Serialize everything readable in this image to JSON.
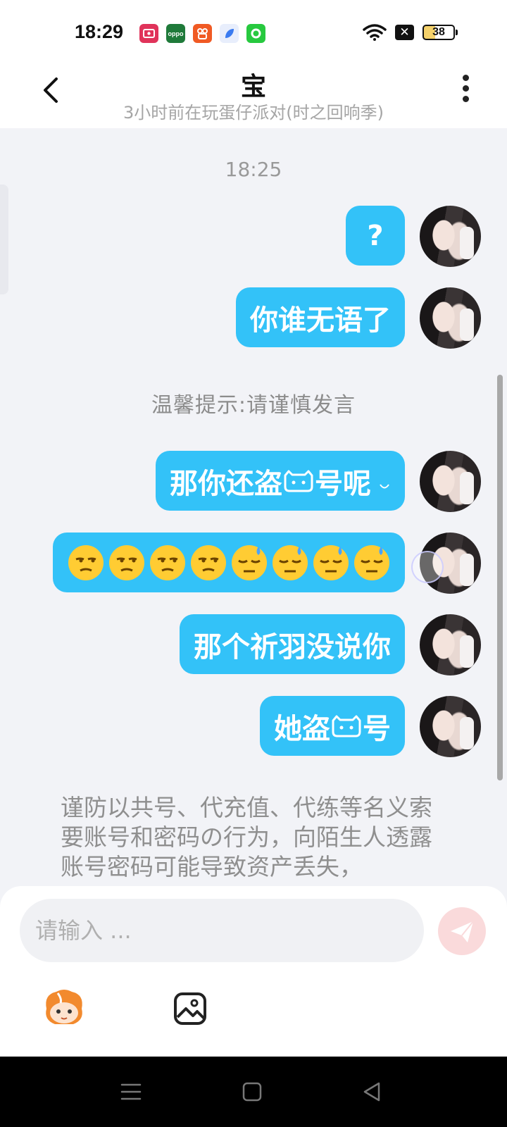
{
  "status_bar": {
    "time": "18:29",
    "battery": "38",
    "app_icons": [
      {
        "name": "screen-recorder-icon",
        "color": "#e0335a",
        "label": ""
      },
      {
        "name": "oppo-icon",
        "color": "#1f7a3a",
        "label": "oppo"
      },
      {
        "name": "kuaishou-icon",
        "color": "#f05a24",
        "label": ""
      },
      {
        "name": "feather-app-icon",
        "color": "#3a7bf0",
        "label": ""
      },
      {
        "name": "green-ring-app-icon",
        "color": "#27c93f",
        "label": ""
      }
    ]
  },
  "header": {
    "title": "宝",
    "subtitle": "3小时前在玩蛋仔派对(时之回响季)"
  },
  "chat": {
    "timestamp": "18:25",
    "tip": "温馨提示:请谨慎发言",
    "messages": [
      {
        "text": "?"
      },
      {
        "text": "你谁无语了"
      },
      {
        "text_before_icon": "那你还盗",
        "text_after_icon": "号呢",
        "suffix_icon": "droplet-icon"
      },
      {
        "emojis": [
          "unamused-face",
          "unamused-face",
          "unamused-face",
          "unamused-face",
          "downcast-sweat-face",
          "downcast-sweat-face",
          "downcast-sweat-face",
          "downcast-sweat-face"
        ]
      },
      {
        "text": "那个祈羽没说你"
      },
      {
        "text_before_icon": "她盗",
        "text_after_icon": "号"
      }
    ],
    "warning": "谨防以共号、代充值、代练等名义索要账号和密码の行为，向陌生人透露账号密码可能导致资产丢失，"
  },
  "input": {
    "placeholder": "请输入 ..."
  },
  "colors": {
    "bubble": "#33c2f8",
    "background": "#f2f3f7",
    "send_button": "#fadadb"
  }
}
